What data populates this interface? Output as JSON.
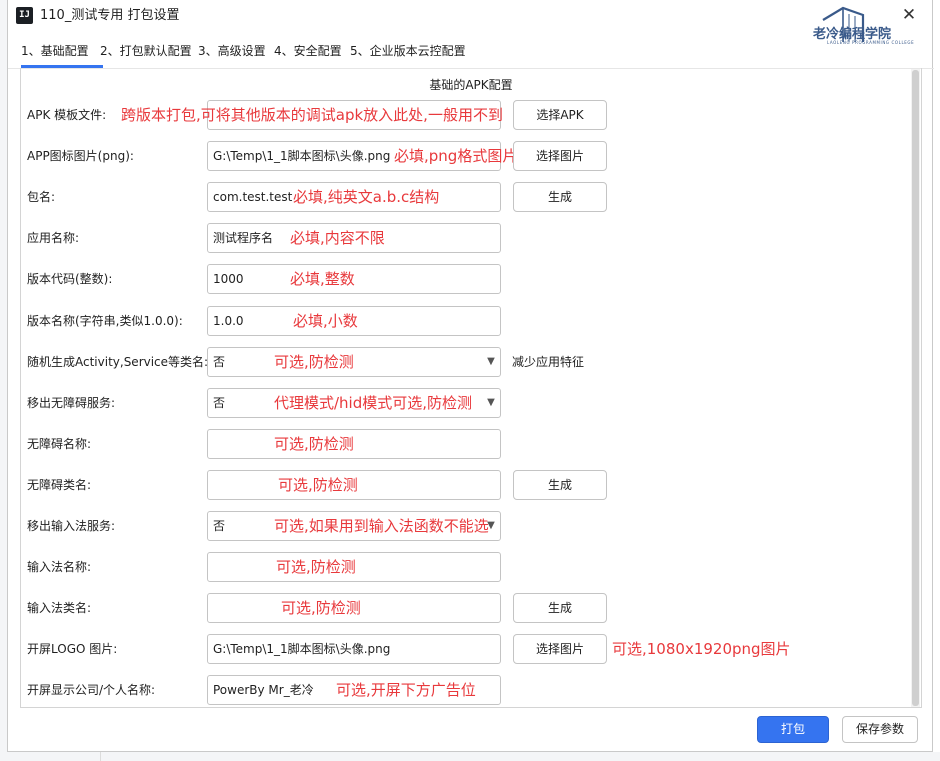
{
  "window": {
    "title": "110_测试专用 打包设置",
    "app_icon_text": "IJ",
    "close_glyph": "✕"
  },
  "logo": {
    "text": "老冷编程学院",
    "subtext": "LAOLENG PROGRAMMING COLLEGE"
  },
  "tabs": [
    {
      "label": "1、基础配置",
      "active": true
    },
    {
      "label": "2、打包默认配置",
      "active": false
    },
    {
      "label": "3、高级设置",
      "active": false
    },
    {
      "label": "4、安全配置",
      "active": false
    },
    {
      "label": "5、企业版本云控配置",
      "active": false
    }
  ],
  "section_title": "基础的APK配置",
  "rows": [
    {
      "label": "APK 模板文件:",
      "value": "",
      "button": "选择APK",
      "note": "跨版本打包,可将其他版本的调试apk放入此处,一般用不到"
    },
    {
      "label": "APP图标图片(png):",
      "value": "G:\\Temp\\1_1脚本图标\\头像.png",
      "button": "选择图片",
      "note": "必填,png格式图片"
    },
    {
      "label": "包名:",
      "value": "com.test.test",
      "button": "生成",
      "note": "必填,纯英文a.b.c结构"
    },
    {
      "label": "应用名称:",
      "value": "测试程序名",
      "note": "必填,内容不限"
    },
    {
      "label": "版本代码(整数):",
      "value": "1000",
      "note": "必填,整数"
    },
    {
      "label": "版本名称(字符串,类似1.0.0):",
      "value": "1.0.0",
      "note": "必填,小数"
    },
    {
      "label": "随机生成Activity,Service等类名:",
      "value": "否",
      "dropdown": true,
      "note": "可选,防检测",
      "hint": "减少应用特征"
    },
    {
      "label": "移出无障碍服务:",
      "value": "否",
      "dropdown": true,
      "note": "代理模式/hid模式可选,防检测"
    },
    {
      "label": "无障碍名称:",
      "value": "",
      "note": "可选,防检测"
    },
    {
      "label": "无障碍类名:",
      "value": "",
      "button": "生成",
      "note": "可选,防检测"
    },
    {
      "label": "移出输入法服务:",
      "value": "否",
      "dropdown": true,
      "note": "可选,如果用到输入法函数不能选"
    },
    {
      "label": "输入法名称:",
      "value": "",
      "note": "可选,防检测"
    },
    {
      "label": "输入法类名:",
      "value": "",
      "button": "生成",
      "note": "可选,防检测"
    },
    {
      "label": "开屏LOGO 图片:",
      "value": "G:\\Temp\\1_1脚本图标\\头像.png",
      "button": "选择图片",
      "note": "可选,1080x1920png图片"
    },
    {
      "label": "开屏显示公司/个人名称:",
      "value": "PowerBy Mr_老冷",
      "note": "可选,开屏下方广告位"
    }
  ],
  "footer": {
    "primary": "打包",
    "secondary": "保存参数"
  },
  "colors": {
    "accent": "#3574f0",
    "note": "#e8393c",
    "logo": "#3a5a8a"
  }
}
